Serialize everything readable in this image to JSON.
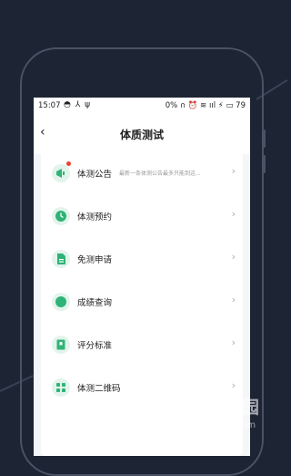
{
  "status_bar": {
    "time": "15:07",
    "left_icons": "◓ ⅄ ψ",
    "right_text": "0% ∩ ⏰ ≋ ııl ⚡ ▭ 79"
  },
  "header": {
    "back_icon": "‹",
    "title": "体质测试"
  },
  "menu": {
    "items": [
      {
        "label": "体测公告",
        "icon": "megaphone-icon",
        "note": "最新一条体测公告最多只能到这..."
      },
      {
        "label": "体测预约",
        "icon": "clock-icon"
      },
      {
        "label": "免测申请",
        "icon": "document-icon"
      },
      {
        "label": "成绩查询",
        "icon": "circle-icon"
      },
      {
        "label": "评分标准",
        "icon": "bookmark-icon"
      },
      {
        "label": "体测二维码",
        "icon": "qr-code-icon"
      }
    ],
    "chevron": "›"
  },
  "colors": {
    "accent": "#2fb377",
    "icon_bg": "#e2f4ec",
    "badge": "#e8452c",
    "background": "#1d2433"
  },
  "watermark": {
    "name": "当下软件园",
    "url": "www.downxia.com"
  }
}
